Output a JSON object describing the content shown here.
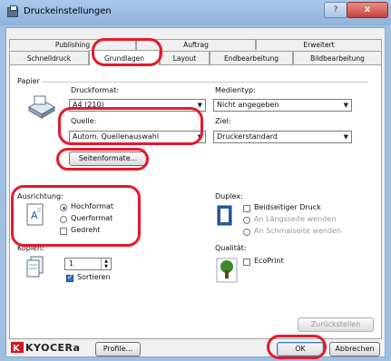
{
  "window": {
    "title": "Druckeinstellungen",
    "help_label": "?",
    "close_label": "x"
  },
  "tabs_row1": [
    "Publishing",
    "Auftrag",
    "Erweitert"
  ],
  "tabs_row2": [
    "Schnelldruck",
    "Grundlagen",
    "Layout",
    "Endbearbeitung",
    "Bildbearbeitung"
  ],
  "paper": {
    "group_label": "Papier",
    "druckformat_label": "Druckformat:",
    "druckformat_value": "A4 (210)",
    "medientyp_label": "Medientyp:",
    "medientyp_value": "Nicht angegeben",
    "quelle_label": "Quelle:",
    "quelle_value": "Autom. Quellenauswahl",
    "ziel_label": "Ziel:",
    "ziel_value": "Druckerstandard",
    "seitenformate_label": "Seitenformate..."
  },
  "orientation": {
    "label": "Ausrichtung:",
    "hochformat": "Hochformat",
    "querformat": "Querformat",
    "gedreht": "Gedreht"
  },
  "duplex": {
    "label": "Duplex:",
    "beidseitig": "Beidseitiger Druck",
    "laengsseite": "An Längsseite wenden",
    "schmalseite": "An Schmalseite wenden"
  },
  "copies": {
    "label": "Kopien:",
    "value": "1",
    "sortieren": "Sortieren"
  },
  "quality": {
    "label": "Qualität:",
    "ecoprint": "EcoPrint"
  },
  "footer": {
    "zuruecksetzen": "Zurückstellen",
    "brand": "KYOCERa",
    "profile": "Profile...",
    "ok": "OK",
    "abbrechen": "Abbrechen"
  },
  "colors": {
    "highlight": "#e6192b",
    "title_bar": "#9fbfe0",
    "accent_blue": "#2d73c8"
  }
}
